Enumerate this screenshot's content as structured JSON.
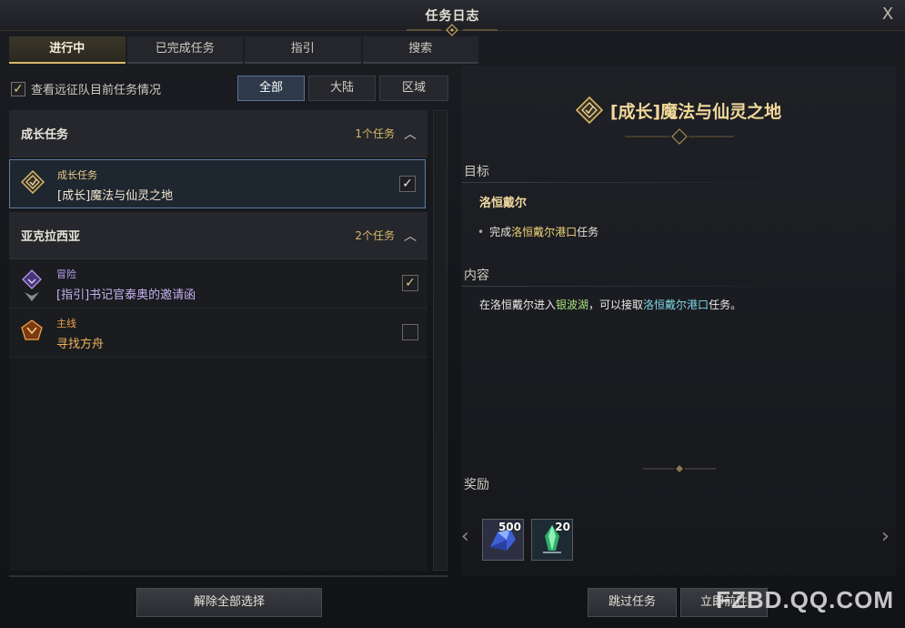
{
  "window": {
    "title": "任务日志",
    "close_label": "X"
  },
  "tabs": [
    {
      "label": "进行中",
      "active": true
    },
    {
      "label": "已完成任务",
      "active": false
    },
    {
      "label": "指引",
      "active": false
    },
    {
      "label": "搜索",
      "active": false
    }
  ],
  "expedition_toggle": {
    "label": "查看远征队目前任务情况",
    "checked": true,
    "mark": "✓"
  },
  "filters": [
    {
      "label": "全部",
      "active": true
    },
    {
      "label": "大陆",
      "active": false
    },
    {
      "label": "区域",
      "active": false
    }
  ],
  "groups": [
    {
      "title": "成长任务",
      "count": "1个任务",
      "quests": [
        {
          "category": "成长任务",
          "name": "[成长]魔法与仙灵之地",
          "category_color": "#e8c98a",
          "name_color": "#f0e6cc",
          "tracked": true,
          "icon": "growth-quest-icon"
        }
      ]
    },
    {
      "title": "亚克拉西亚",
      "count": "2个任务",
      "quests": [
        {
          "category": "冒险",
          "name": "[指引]书记官泰奥的邀请函",
          "category_color": "#b59be8",
          "name_color": "#c6b1f0",
          "tracked": true,
          "icon": "adventure-quest-icon"
        },
        {
          "category": "主线",
          "name": "寻找方舟",
          "category_color": "#f0a24a",
          "name_color": "#f2b35a",
          "tracked": false,
          "icon": "main-quest-icon"
        }
      ]
    }
  ],
  "buttons": {
    "deselect_all": "解除全部选择",
    "skip_quest": "跳过任务",
    "go_now": "立即前往"
  },
  "detail": {
    "title": "[成长]魔法与仙灵之地",
    "objective_label": "目标",
    "objective_location": "洛恒戴尔",
    "objective_bullet": "•",
    "objective_prefix": "完成",
    "objective_highlight": "洛恒戴尔港口",
    "objective_suffix": "任务",
    "content_label": "内容",
    "content_part1": "在洛恒戴尔进入",
    "content_hl1": "银波湖",
    "content_part2": "，可以接取",
    "content_hl2": "洛恒戴尔港口",
    "content_part3": "任务。",
    "reward_label": "奖励",
    "rewards": [
      {
        "count": "500",
        "icon": "blue-crystal-icon"
      },
      {
        "count": "20",
        "icon": "green-crystal-icon"
      }
    ],
    "prev_arrow": "‹",
    "next_arrow": "›"
  },
  "watermark": "FZBD.QQ.COM",
  "colors": {
    "accent_gold": "#d9b86a",
    "selected_border": "#5f7fa6"
  }
}
